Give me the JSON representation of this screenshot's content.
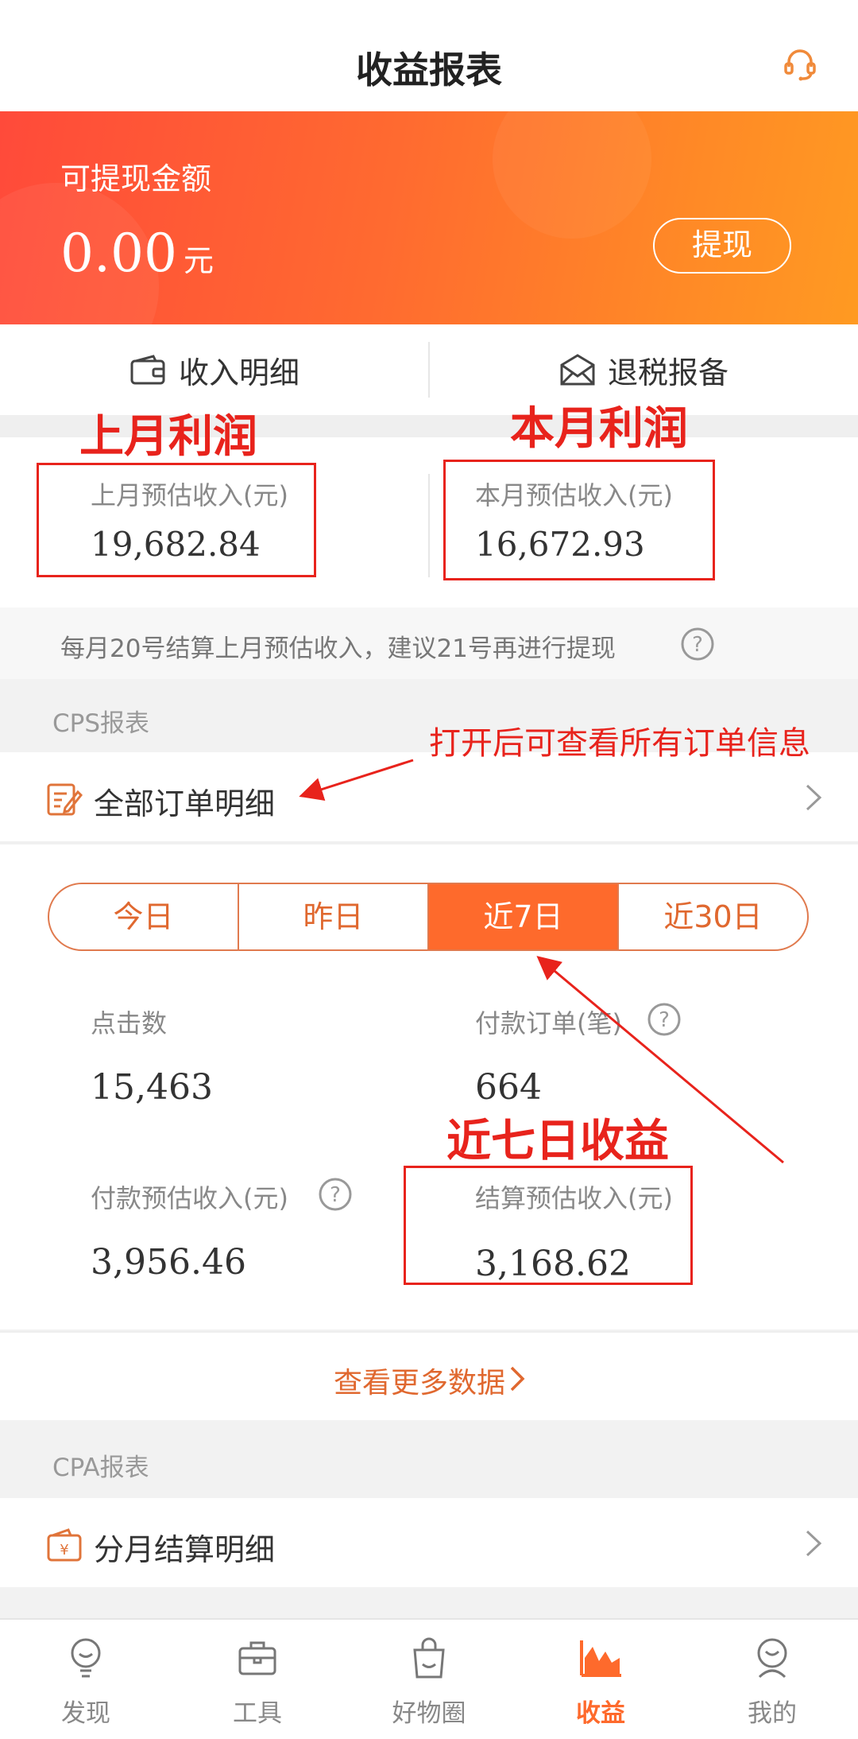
{
  "header": {
    "title": "收益报表",
    "support_icon": "headset-icon"
  },
  "banner": {
    "label": "可提现金额",
    "amount": "0.00",
    "unit": "元",
    "withdraw_label": "提现"
  },
  "tabs_top": {
    "income_detail": "收入明细",
    "tax_refund": "退税报备"
  },
  "monthly": {
    "last_label": "上月预估收入(元)",
    "last_value": "19,682.84",
    "this_label": "本月预估收入(元)",
    "this_value": "16,672.93"
  },
  "notice": "每月20号结算上月预估收入，建议21号再进行提现",
  "cps": {
    "section": "CPS报表",
    "all_orders": "全部订单明细"
  },
  "periods": {
    "today": "今日",
    "yesterday": "昨日",
    "last7": "近7日",
    "last30": "近30日"
  },
  "stats": {
    "clicks_label": "点击数",
    "clicks_value": "15,463",
    "orders_label": "付款订单(笔)",
    "orders_value": "664",
    "paid_label": "付款预估收入(元)",
    "paid_value": "3,956.46",
    "settle_label": "结算预估收入(元)",
    "settle_value": "3,168.62"
  },
  "more_data": "查看更多数据",
  "cpa": {
    "section": "CPA报表",
    "monthly_settle": "分月结算明细"
  },
  "annotations": {
    "last_profit": "上月利润",
    "this_profit": "本月利润",
    "orders_hint": "打开后可查看所有订单信息",
    "seven_day": "近七日收益"
  },
  "nav": {
    "discover": "发现",
    "tools": "工具",
    "goods": "好物圈",
    "earnings": "收益",
    "mine": "我的"
  },
  "colors": {
    "accent": "#fe6a2c",
    "annotation": "#e8231c"
  }
}
